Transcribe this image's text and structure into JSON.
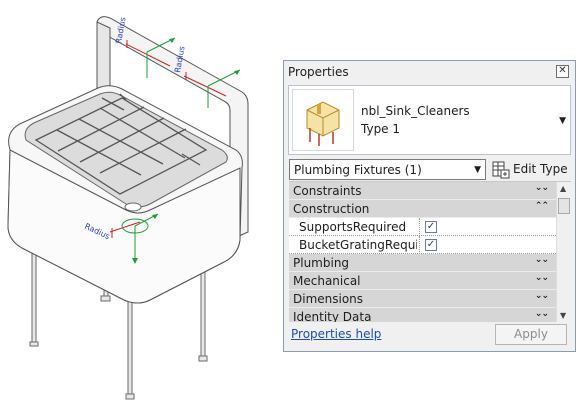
{
  "viewport": {
    "dimension_labels": [
      "Radius",
      "Radius",
      "Radius"
    ]
  },
  "properties": {
    "title": "Properties",
    "close_glyph": "✕",
    "family_name": "nbl_Sink_Cleaners",
    "type_name": "Type 1",
    "category_filter": "Plumbing Fixtures (1)",
    "edit_type_label": "Edit Type",
    "groups": [
      {
        "label": "Constraints",
        "state": "collapsed"
      },
      {
        "label": "Construction",
        "state": "expanded"
      },
      {
        "label": "Plumbing",
        "state": "collapsed"
      },
      {
        "label": "Mechanical",
        "state": "collapsed"
      },
      {
        "label": "Dimensions",
        "state": "collapsed"
      },
      {
        "label": "Identity Data",
        "state": "collapsed"
      }
    ],
    "parameters": [
      {
        "label": "SupportsRequired",
        "checked": true
      },
      {
        "label": "BucketGratingRequir...",
        "checked": true
      }
    ],
    "collapsed_glyph": "»",
    "expanded_glyph": "«",
    "checkmark_glyph": "✓",
    "help_link": "Properties help",
    "apply_label": "Apply"
  },
  "colors": {
    "dimension_label": "#2a3fc0",
    "axis_green": "#1e9e3a",
    "dimension_red": "#d42020",
    "link_blue": "#1e4bb5"
  }
}
